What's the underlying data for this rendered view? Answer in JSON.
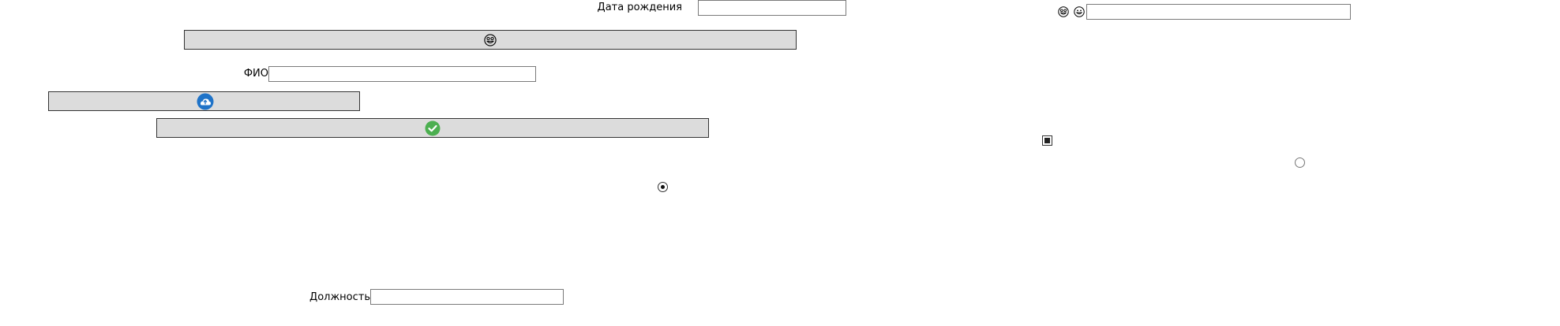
{
  "form": {
    "birthdate_label": "Дата рождения",
    "birthdate_value": "",
    "fio_label": "ФИО",
    "fio_value": "",
    "position_label": "Должность",
    "position_value": "",
    "right_field_value": ""
  },
  "buttons": {
    "emoji_button_icon": "grinning-face-icon",
    "cloud_button_icon": "cloud-upload-icon",
    "check_button_icon": "check-circle-icon"
  },
  "right_icons": [
    "grinning-face-icon",
    "smiling-face-icon"
  ],
  "controls": {
    "checkbox_checked": true,
    "radio_left_checked": true,
    "radio_right_checked": false
  },
  "colors": {
    "button_bg": "#dcdcdc",
    "cloud_blue": "#1f73c8",
    "check_green": "#4caf50"
  }
}
